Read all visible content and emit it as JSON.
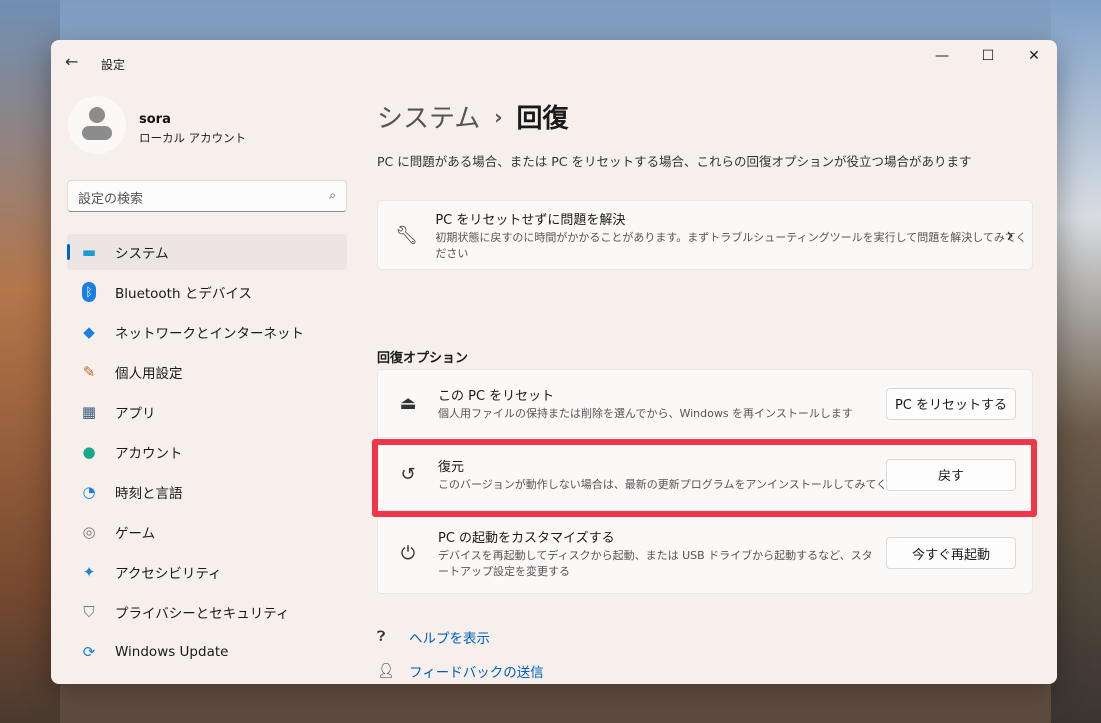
{
  "window": {
    "title": "設定",
    "back": "←",
    "minimize": "—",
    "maximize": "☐",
    "close": "✕"
  },
  "user": {
    "name": "sora",
    "type": "ローカル アカウント"
  },
  "search": {
    "placeholder": "設定の検索"
  },
  "nav": [
    {
      "label": "システム",
      "icon": "▬"
    },
    {
      "label": "Bluetooth とデバイス",
      "icon": "ᛒ"
    },
    {
      "label": "ネットワークとインターネット",
      "icon": "◆"
    },
    {
      "label": "個人用設定",
      "icon": "✎"
    },
    {
      "label": "アプリ",
      "icon": "▦"
    },
    {
      "label": "アカウント",
      "icon": "●"
    },
    {
      "label": "時刻と言語",
      "icon": "◔"
    },
    {
      "label": "ゲーム",
      "icon": "◎"
    },
    {
      "label": "アクセシビリティ",
      "icon": "✦"
    },
    {
      "label": "プライバシーとセキュリティ",
      "icon": "⛉"
    },
    {
      "label": "Windows Update",
      "icon": "⟳"
    }
  ],
  "breadcrumb": {
    "parent": "システム",
    "sep": "›",
    "current": "回復"
  },
  "description": "PC に問題がある場合、または PC をリセットする場合、これらの回復オプションが役立つ場合があります",
  "troubleshoot": {
    "title": "PC をリセットせずに問題を解決",
    "subtitle": "初期状態に戻すのに時間がかかることがあります。まずトラブルシューティングツールを実行して問題を解決してみてください",
    "chevron": "›"
  },
  "section_title": "回復オプション",
  "options": [
    {
      "title": "この PC をリセット",
      "subtitle": "個人用ファイルの保持または削除を選んでから、Windows を再インストールします",
      "button": "PC をリセットする"
    },
    {
      "title": "復元",
      "subtitle": "このバージョンが動作しない場合は、最新の更新プログラムをアンインストールしてみてください",
      "button": "戻す"
    },
    {
      "title": "PC の起動をカスタマイズする",
      "subtitle": "デバイスを再起動してディスクから起動、または USB ドライブから起動するなど、スタートアップ設定を変更する",
      "button": "今すぐ再起動"
    }
  ],
  "links": {
    "help": "ヘルプを表示",
    "feedback": "フィードバックの送信"
  },
  "colors": {
    "accent": "#0067c0",
    "highlight": "#f0364a"
  }
}
